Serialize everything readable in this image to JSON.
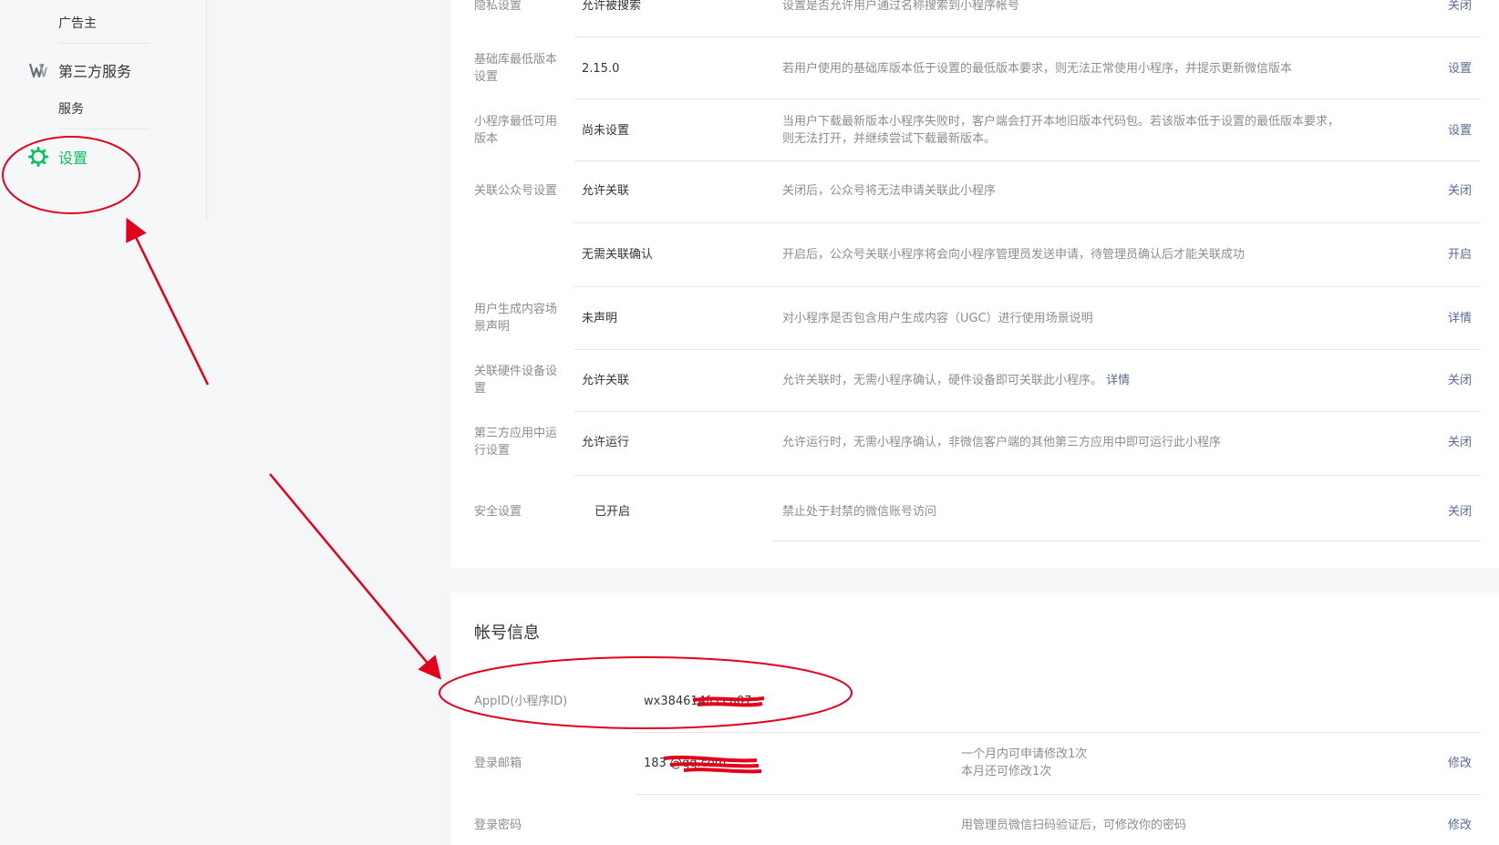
{
  "sidebar": {
    "advertiser": "广告主",
    "third_party": "第三方服务",
    "service": "服务",
    "settings": "设置"
  },
  "settings_rows": [
    {
      "label": "隐私设置",
      "value": "允许被搜索",
      "desc": "设置是否允许用户通过名称搜索到小程序帐号",
      "action": "关闭"
    },
    {
      "label": "基础库最低版本设置",
      "value": "2.15.0",
      "desc": "若用户使用的基础库版本低于设置的最低版本要求，则无法正常使用小程序，并提示更新微信版本",
      "action": "设置"
    },
    {
      "label": "小程序最低可用版本",
      "value": "尚未设置",
      "desc": "当用户下载最新版本小程序失败时，客户端会打开本地旧版本代码包。若该版本低于设置的最低版本要求，则无法打开，并继续尝试下载最新版本。",
      "action": "设置"
    },
    {
      "label": "关联公众号设置",
      "value": "允许关联",
      "desc": "关闭后，公众号将无法申请关联此小程序",
      "action": "关闭"
    },
    {
      "label": "",
      "value": "无需关联确认",
      "desc": "开启后，公众号关联小程序将会向小程序管理员发送申请，待管理员确认后才能关联成功",
      "action": "开启"
    },
    {
      "label": "用户生成内容场景声明",
      "value": "未声明",
      "desc": "对小程序是否包含用户生成内容（UGC）进行使用场景说明",
      "action": "详情"
    },
    {
      "label": "关联硬件设备设置",
      "value": "允许关联",
      "desc": "允许关联时，无需小程序确认，硬件设备即可关联此小程序。",
      "desc_link": "详情",
      "action": "关闭"
    },
    {
      "label": "第三方应用中运行设置",
      "value": "允许运行",
      "desc": "允许运行时，无需小程序确认，非微信客户端的其他第三方应用中即可运行此小程序",
      "action": "关闭"
    },
    {
      "label": "安全设置",
      "value": "已开启",
      "desc": "禁止处于封禁的微信账号访问",
      "action": "关闭"
    }
  ],
  "account": {
    "title": "帐号信息",
    "appid_label": "AppID(小程序ID)",
    "appid_value": "wx384614fccca07",
    "email_label": "登录邮箱",
    "email_value": "183            @qq.com",
    "email_note1": "一个月内可申请修改1次",
    "email_note2": "本月还可修改1次",
    "email_action": "修改",
    "password_label": "登录密码",
    "password_note": "用管理员微信扫码验证后，可修改你的密码",
    "password_action": "修改"
  },
  "colors": {
    "accent": "#07c160",
    "link": "#576b95",
    "annotation": "#e2001a"
  }
}
